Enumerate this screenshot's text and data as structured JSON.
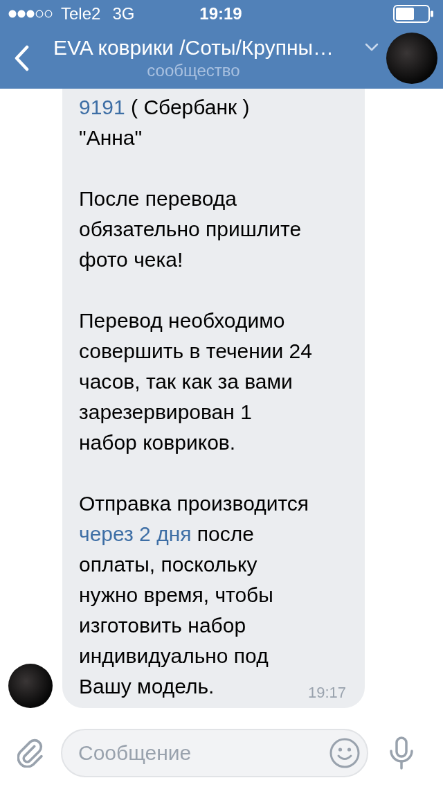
{
  "status_bar": {
    "carrier": "Tele2",
    "network": "3G",
    "time": "19:19"
  },
  "header": {
    "title": "EVA коврики /Соты/Крупны…",
    "subtitle": "сообщество"
  },
  "messages": [
    {
      "paragraphs": [
        [
          {
            "kind": "link",
            "text": "9191"
          },
          {
            "kind": "text",
            "text": " ( Сбербанк )\n\"Анна\""
          }
        ],
        [
          {
            "kind": "text",
            "text": "После перевода\nобязательно пришлите\nфото чека!"
          }
        ],
        [
          {
            "kind": "text",
            "text": "Перевод необходимо\nсовершить в течении 24\nчасов, так как за вами\nзарезервирован 1\nнабор ковриков."
          }
        ],
        [
          {
            "kind": "text",
            "text": "Отправка производится\n"
          },
          {
            "kind": "link",
            "text": "через 2 дня"
          },
          {
            "kind": "text",
            "text": " после\nоплаты, поскольку\nнужно время, чтобы\nизготовить набор\nиндивидуально под\nВашу модель."
          }
        ]
      ],
      "time": "19:17"
    }
  ],
  "composer": {
    "placeholder": "Сообщение"
  }
}
